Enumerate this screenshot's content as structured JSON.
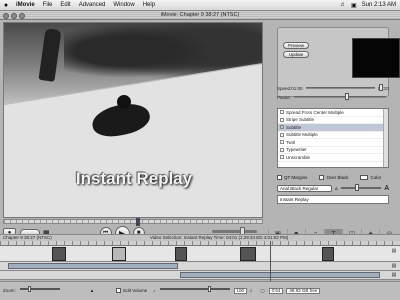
{
  "menubar": {
    "apple": "",
    "items": [
      "iMovie",
      "File",
      "Edit",
      "Advanced",
      "Window",
      "Help"
    ],
    "clock": "Sun 2:13 AM"
  },
  "window": {
    "title": "iMovie: Chapter 9 38:27 (NTSC)"
  },
  "viewer": {
    "caption": "Instant Replay"
  },
  "preview_panel": {
    "preview_label": "Preview",
    "update_label": "Update",
    "speed_label": "Speed:",
    "speed_start": "01:00",
    "speed_end": "04:20",
    "pause_label": "Pause:",
    "speed_fraction": 0.72,
    "pause_fraction": 0.5
  },
  "titles_list": [
    "Spread From Center Multiple",
    "Stripe Subtitle",
    "Subtitle",
    "Subtitle Multiple",
    "Twirl",
    "Typewriter",
    "Unscramble"
  ],
  "selected_title_index": 2,
  "options": {
    "qt_margins": "QT Margins",
    "over_black": "Over Black",
    "color": "Color"
  },
  "font": {
    "name": "Arial Black Regular",
    "small_a": "A",
    "big_a": "A"
  },
  "text_field": {
    "value": "Instant Replay"
  },
  "tools": [
    "Clips",
    "Photos",
    "Audio",
    "Titles",
    "Trans",
    "Effects",
    "iDVD"
  ],
  "active_tool_index": 3,
  "timeline_info": {
    "left": "Chapter 9  38:27 (NTSC)",
    "center": "Video Selection: Instant Replay  Time: 04:01 (1:29:34 ED 4:01:52 PM)"
  },
  "bottom_bar": {
    "zoom_label": "Zoom:",
    "edit_volume_label": "Edit Volume",
    "volume_value": "100",
    "size_value": "0:64",
    "free_space": "38.93 GB free"
  },
  "transport": {
    "volume_fraction": 0.7
  }
}
